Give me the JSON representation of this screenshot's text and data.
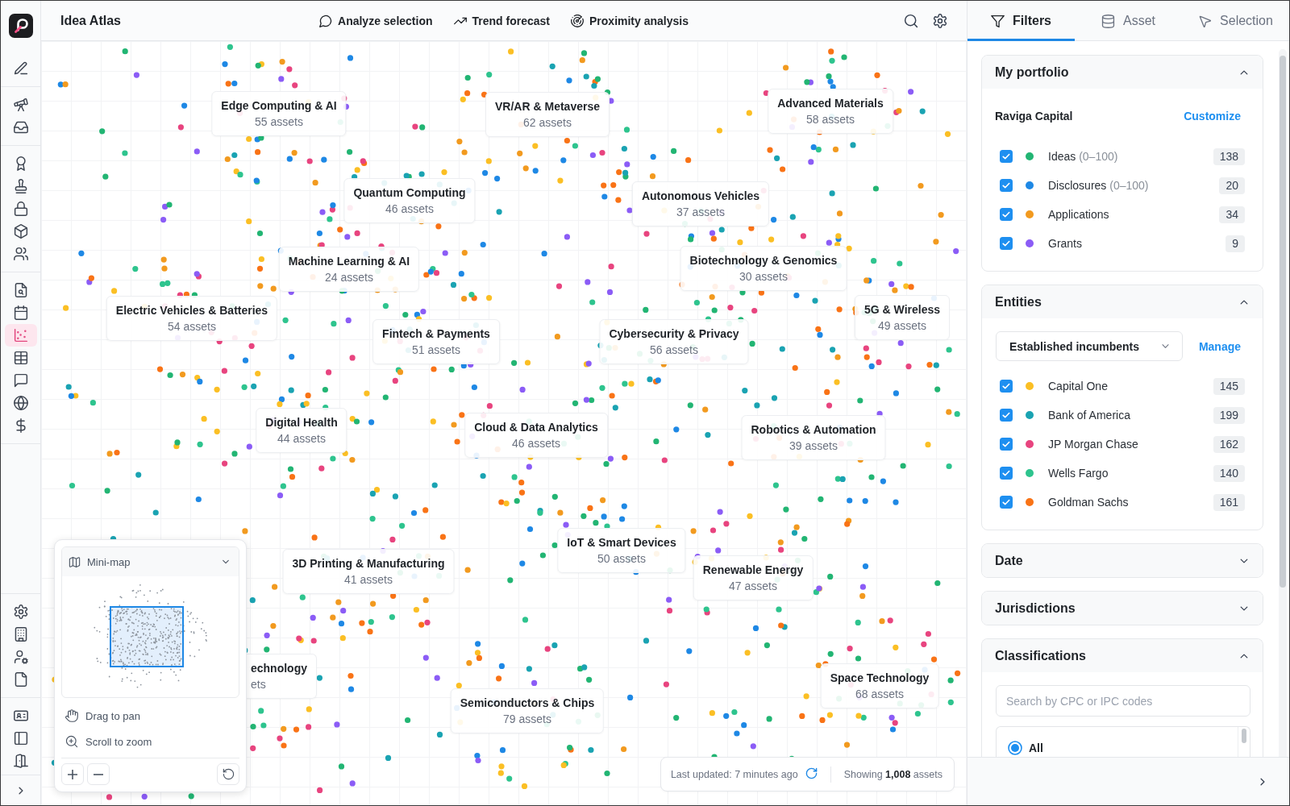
{
  "sidebar": {
    "top_groups": [
      {
        "items": [
          {
            "selected": false
          }
        ]
      },
      {
        "items": [
          {
            "selected": false
          },
          {
            "selected": false
          }
        ]
      },
      {
        "items": [
          {
            "selected": false
          },
          {
            "selected": false
          },
          {
            "selected": false
          },
          {
            "selected": false
          },
          {
            "selected": false
          }
        ]
      },
      {
        "items": [
          {
            "selected": false
          },
          {
            "selected": false
          },
          {
            "selected": true
          },
          {
            "selected": false
          },
          {
            "selected": false
          },
          {
            "selected": false
          },
          {
            "selected": false
          }
        ]
      }
    ],
    "bottom_groups": [
      {
        "items": [
          {
            "selected": false
          },
          {
            "selected": false
          },
          {
            "selected": false
          },
          {
            "selected": false
          }
        ]
      },
      {
        "items": [
          {
            "selected": false
          },
          {
            "selected": false
          },
          {
            "selected": false
          }
        ]
      }
    ]
  },
  "toolbar": {
    "title": "Idea Atlas",
    "actions": [
      "Analyze selection",
      "Trend forecast",
      "Proximity analysis"
    ]
  },
  "canvas": {
    "clusters": [
      {
        "name": "Edge Computing & AI",
        "count": "55 assets"
      },
      {
        "name": "VR/AR & Metaverse",
        "count": "62 assets"
      },
      {
        "name": "Advanced Materials",
        "count": "58 assets"
      },
      {
        "name": "Quantum Computing",
        "count": "46 assets"
      },
      {
        "name": "Autonomous Vehicles",
        "count": "37 assets"
      },
      {
        "name": "Machine Learning & AI",
        "count": "24 assets"
      },
      {
        "name": "Biotechnology & Genomics",
        "count": "30 assets"
      },
      {
        "name": "Electric Vehicles & Batteries",
        "count": "54 assets"
      },
      {
        "name": "5G & Wireless",
        "count": "49 assets"
      },
      {
        "name": "Fintech & Payments",
        "count": "51 assets"
      },
      {
        "name": "Cybersecurity & Privacy",
        "count": "56 assets"
      },
      {
        "name": "Digital Health",
        "count": "44 assets"
      },
      {
        "name": "Cloud & Data Analytics",
        "count": "46 assets"
      },
      {
        "name": "Robotics & Automation",
        "count": "39 assets"
      },
      {
        "name": "IoT & Smart Devices",
        "count": "50 assets"
      },
      {
        "name": "3D Printing & Manufacturing",
        "count": "41 assets"
      },
      {
        "name": "Renewable Energy",
        "count": "47 assets"
      },
      {
        "name": "echnology",
        "count": "ets"
      },
      {
        "name": "Space Technology",
        "count": "68 assets"
      },
      {
        "name": "Semiconductors & Chips",
        "count": "79 assets"
      }
    ],
    "minimap": {
      "title": "Mini-map",
      "hints": [
        "Drag to pan",
        "Scroll to zoom"
      ]
    },
    "status_bar": {
      "updated": "Last updated: 7 minutes ago",
      "showing": "Showing **1,008** assets"
    }
  },
  "panel": {
    "tabs": [
      {
        "label": "Filters",
        "selected": true
      },
      {
        "label": "Asset",
        "selected": false
      },
      {
        "label": "Selection",
        "selected": false
      }
    ],
    "sections": [
      {
        "title": "My portfolio",
        "expanded": true,
        "owner": "Raviga Capital",
        "link": "Customize",
        "items": [
          {
            "label": "Ideas",
            "range": "(0–100)",
            "checked": true,
            "color": "#22b573",
            "count": "138"
          },
          {
            "label": "Disclosures",
            "range": "(0–100)",
            "checked": true,
            "color": "#1e88e5",
            "count": "20"
          },
          {
            "label": "Applications",
            "checked": true,
            "color": "#f29a1f",
            "count": "34"
          },
          {
            "label": "Grants",
            "checked": true,
            "color": "#8b5cf6",
            "count": "9"
          }
        ]
      },
      {
        "title": "Entities",
        "expanded": true,
        "dropdown": "Established incumbents",
        "link": "Manage",
        "items": [
          {
            "label": "Capital One",
            "checked": true,
            "color": "#fbbf24",
            "count": "145"
          },
          {
            "label": "Bank of America",
            "checked": true,
            "color": "#1aa3b2",
            "count": "199"
          },
          {
            "label": "JP Morgan Chase",
            "checked": true,
            "color": "#e8447f",
            "count": "162"
          },
          {
            "label": "Wells Fargo",
            "checked": true,
            "color": "#2ec48e",
            "count": "140"
          },
          {
            "label": "Goldman Sachs",
            "checked": true,
            "color": "#f97316",
            "count": "161"
          }
        ]
      },
      {
        "title": "Date",
        "expanded": false
      },
      {
        "title": "Jurisdictions",
        "expanded": false
      },
      {
        "title": "Classifications",
        "expanded": true,
        "search": {
          "placeholder": "Search by CPC or IPC codes"
        },
        "options": [
          {
            "label": "All",
            "selected": true
          }
        ]
      }
    ]
  }
}
